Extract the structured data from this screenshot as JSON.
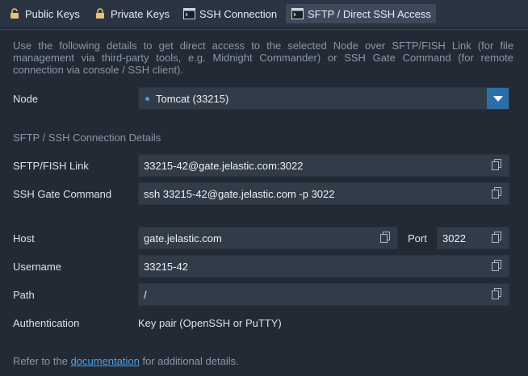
{
  "tabs": [
    {
      "label": "Public Keys",
      "icon": "unlock-icon"
    },
    {
      "label": "Private Keys",
      "icon": "lock-icon"
    },
    {
      "label": "SSH Connection",
      "icon": "terminal-icon"
    },
    {
      "label": "SFTP / Direct SSH Access",
      "icon": "terminal-icon",
      "active": true
    }
  ],
  "description": "Use the following details to get direct access to the selected Node over SFTP/FISH Link (for file management via third-party tools, e.g. Midnight Commander) or SSH Gate Command (for remote connection via console / SSH client).",
  "node": {
    "label": "Node",
    "value": "Tomcat (33215)"
  },
  "section_title": "SFTP / SSH Connection Details",
  "sftp_link": {
    "label": "SFTP/FISH Link",
    "value": "33215-42@gate.jelastic.com:3022"
  },
  "ssh_command": {
    "label": "SSH Gate Command",
    "value": "ssh 33215-42@gate.jelastic.com -p 3022"
  },
  "host": {
    "label": "Host",
    "value": "gate.jelastic.com"
  },
  "port": {
    "label": "Port",
    "value": "3022"
  },
  "username": {
    "label": "Username",
    "value": "33215-42"
  },
  "path": {
    "label": "Path",
    "value": "/"
  },
  "authentication": {
    "label": "Authentication",
    "value": "Key pair (OpenSSH or PuTTY)"
  },
  "footer": {
    "prefix": "Refer to the",
    "link": "documentation",
    "suffix": "for additional details."
  },
  "colors": {
    "background": "#222a35",
    "accent": "#2a6fa8",
    "link": "#4aa3e6"
  }
}
